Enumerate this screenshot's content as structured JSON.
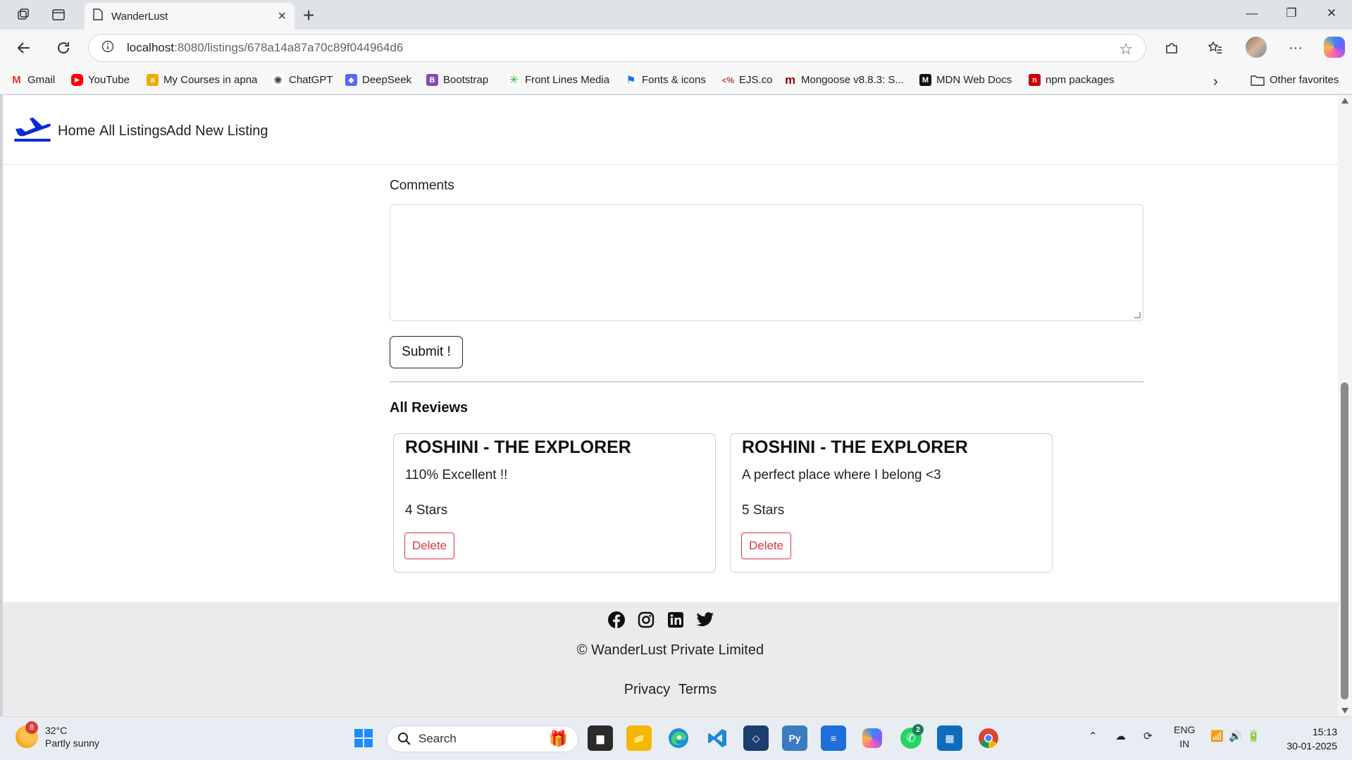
{
  "browser": {
    "tab_title": "WanderLust",
    "url_host": "localhost",
    "url_rest": ":8080/listings/678a14a87a70c89f044964d6"
  },
  "bookmarks": [
    {
      "label": "Gmail",
      "icon": "gmail-icon",
      "color": "#d93025"
    },
    {
      "label": "YouTube",
      "icon": "youtube-icon",
      "color": "#ff0000"
    },
    {
      "label": "My Courses in apna",
      "icon": "apna-icon",
      "color": "#f2a900"
    },
    {
      "label": "ChatGPT",
      "icon": "chatgpt-icon",
      "color": "#444444"
    },
    {
      "label": "DeepSeek",
      "icon": "deepseek-icon",
      "color": "#4d6bfe"
    },
    {
      "label": "Bootstrap",
      "icon": "bootstrap-icon",
      "color": "#7952b3"
    },
    {
      "label": "Front Lines Media",
      "icon": "frontlines-icon",
      "color": "#3cb043"
    },
    {
      "label": "Fonts & icons",
      "icon": "flag-icon",
      "color": "#1a73e8"
    },
    {
      "label": "EJS.co",
      "icon": "ejs-icon",
      "color": "#b4433a"
    },
    {
      "label": "Mongoose v8.8.3: S...",
      "icon": "mongoose-icon",
      "color": "#880000"
    },
    {
      "label": "MDN Web Docs",
      "icon": "mdn-icon",
      "color": "#111111"
    },
    {
      "label": "npm packages",
      "icon": "npm-icon",
      "color": "#cb0000"
    }
  ],
  "other_favorites": "Other favorites",
  "site": {
    "nav": {
      "home": "Home",
      "all_listings": "All Listings",
      "add_new": "Add New Listing"
    },
    "form": {
      "comments_label": "Comments",
      "submit": "Submit !"
    },
    "reviews_heading": "All Reviews",
    "reviews": [
      {
        "author": "ROSHINI - THE EXPLORER",
        "comment": "110% Excellent !!",
        "rating": "4 Stars",
        "delete": "Delete"
      },
      {
        "author": "ROSHINI - THE EXPLORER",
        "comment": "A perfect place where I belong <3",
        "rating": "5 Stars",
        "delete": "Delete"
      }
    ],
    "footer": {
      "copyright": "© WanderLust Private Limited",
      "privacy": "Privacy",
      "terms": "Terms"
    }
  },
  "taskbar": {
    "weather_temp": "32°C",
    "weather_desc": "Partly sunny",
    "weather_badge": "8",
    "search_placeholder": "Search",
    "whatsapp_badge": "2",
    "lang_top": "ENG",
    "lang_bottom": "IN",
    "time": "15:13",
    "date": "30-01-2025"
  },
  "colors": {
    "accent_red": "#dc3545",
    "logo_blue": "#0a2bd6"
  }
}
